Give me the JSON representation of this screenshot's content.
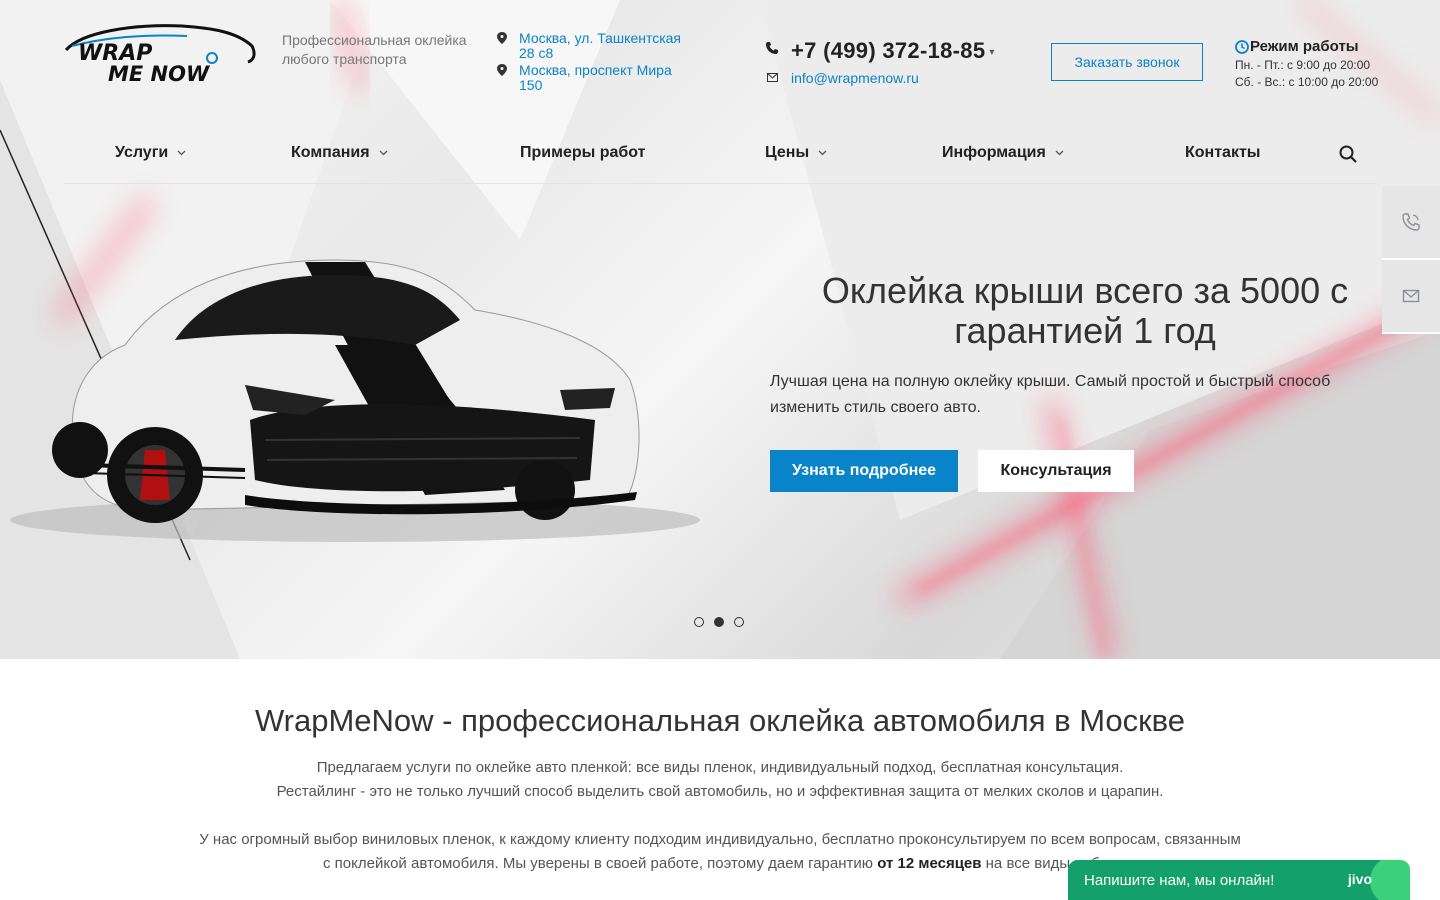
{
  "header": {
    "logo_line1": "WRAP",
    "logo_line2": "ME NOW",
    "slogan": "Профессиональная оклейка любого транспорта",
    "addresses": [
      "Москва, ул. Ташкентская 28 с8",
      "Москва, проспект Мира 150"
    ],
    "phone": "+7 (499) 372-18-85",
    "email": "info@wrapmenow.ru",
    "callback_label": "Заказать звонок",
    "hours_title": "Режим работы",
    "hours": [
      "Пн. - Пт.: с 9:00 до 20:00",
      "Сб. - Вс.: с 10:00 до 20:00"
    ]
  },
  "nav": {
    "items": [
      {
        "label": "Услуги",
        "dropdown": true
      },
      {
        "label": "Компания",
        "dropdown": true
      },
      {
        "label": "Примеры работ",
        "dropdown": false
      },
      {
        "label": "Цены",
        "dropdown": true
      },
      {
        "label": "Информация",
        "dropdown": true
      },
      {
        "label": "Контакты",
        "dropdown": false
      }
    ],
    "search_icon": "search-icon"
  },
  "side_widget": {
    "icons": [
      "phone-call-icon",
      "mail-icon"
    ]
  },
  "slide": {
    "title": "Оклейка крыши всего за 5000 с гарантией 1 год",
    "text": "Лучшая цена на полную оклейку крыши. Самый простой и быстрый способ изменить стиль своего авто.",
    "primary_button": "Узнать подробнее",
    "secondary_button": "Консультация",
    "dots_count": 3,
    "active_dot": 2
  },
  "intro": {
    "title": "WrapMeNow - профессиональная оклейка автомобиля в Москве",
    "p1_line1": "Предлагаем услуги по оклейке авто пленкой: все виды пленок, индивидуальный подход, бесплатная консультация.",
    "p1_line2": "Рестайлинг - это не только лучший способ выделить свой автомобиль, но и эффективная защита от мелких сколов и царапин.",
    "p2_line1": "У нас огромный выбор виниловых пленок, к каждому клиенту подходим индивидуально, бесплатно проконсультируем по всем вопросам, связанным",
    "p2_line2_start": "с поклейкой автомобиля. Мы уверены в своей работе, поэтому даем гарантию ",
    "p2_line2_bold": "от 12 месяцев",
    "p2_line2_end": " на все виды работ."
  },
  "chat": {
    "label": "Напишите нам, мы онлайн!",
    "brand": "jivo"
  },
  "colors": {
    "accent": "#0a84c8",
    "chat": "#14a06a",
    "neon": "#ff3b5c"
  }
}
